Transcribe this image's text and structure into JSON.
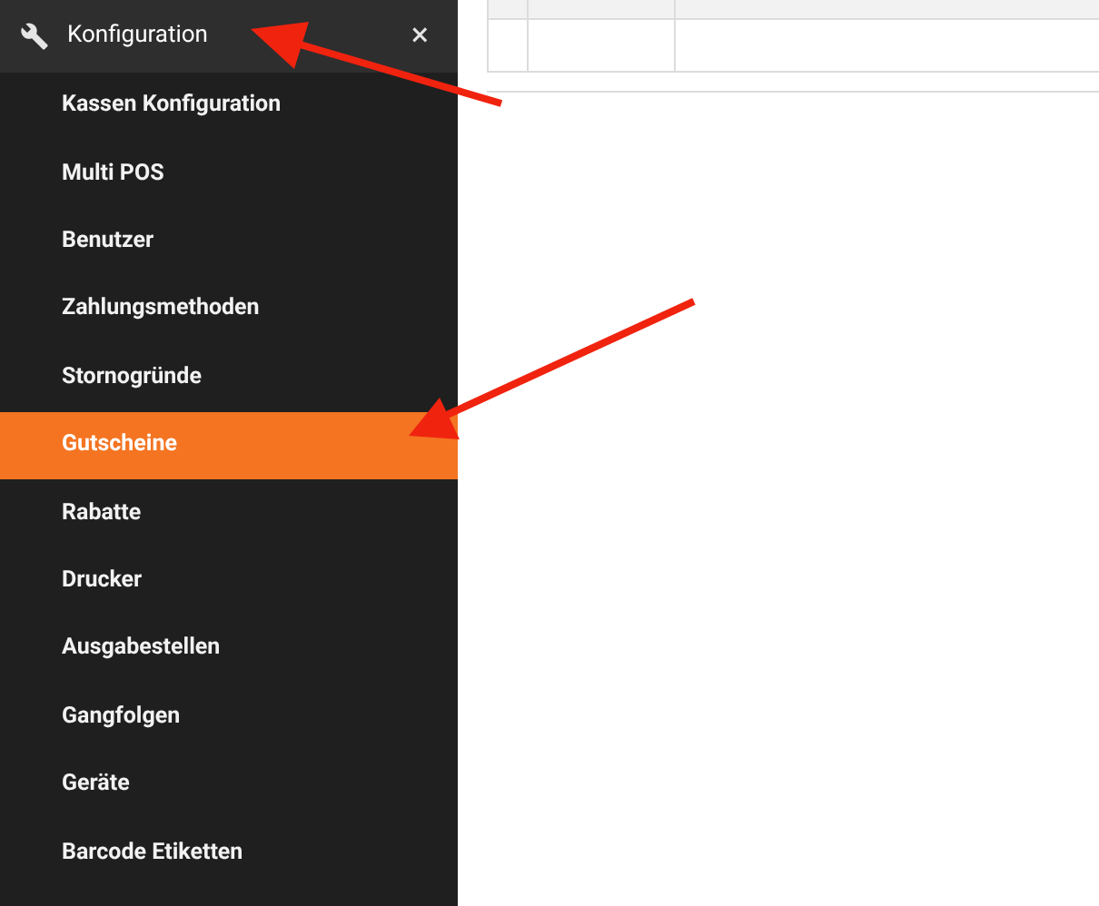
{
  "sidebar": {
    "header": {
      "title": "Konfiguration",
      "close": "×"
    },
    "items": [
      {
        "label": "Kassen Konfiguration",
        "selected": false
      },
      {
        "label": "Multi POS",
        "selected": false
      },
      {
        "label": "Benutzer",
        "selected": false
      },
      {
        "label": "Zahlungsmethoden",
        "selected": false
      },
      {
        "label": "Stornogründe",
        "selected": false
      },
      {
        "label": "Gutscheine",
        "selected": true
      },
      {
        "label": "Rabatte",
        "selected": false
      },
      {
        "label": "Drucker",
        "selected": false
      },
      {
        "label": "Ausgabestellen",
        "selected": false
      },
      {
        "label": "Gangfolgen",
        "selected": false
      },
      {
        "label": "Geräte",
        "selected": false
      },
      {
        "label": "Barcode Etiketten",
        "selected": false
      }
    ]
  }
}
